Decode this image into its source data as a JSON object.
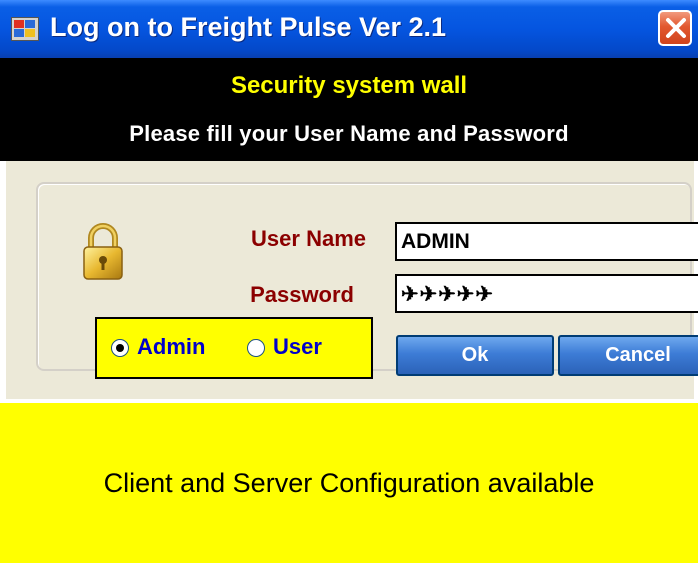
{
  "window": {
    "title": "Log on to Freight Pulse Ver 2.1",
    "app_icon": "app-window-icon",
    "close_icon": "close-icon"
  },
  "header": {
    "title": "Security system wall",
    "subtitle": "Please fill your User Name and Password"
  },
  "form": {
    "lock_icon": "padlock-icon",
    "username_label": "User Name",
    "username_value": "ADMIN",
    "password_label": "Password",
    "password_value": "✈✈✈✈✈",
    "role_options": [
      {
        "label": "Admin",
        "selected": true
      },
      {
        "label": "User",
        "selected": false
      }
    ],
    "ok_label": "Ok",
    "cancel_label": "Cancel"
  },
  "footer": {
    "text": "Client and Server Configuration available"
  },
  "colors": {
    "header_bg": "#000000",
    "header_title": "#ffff00",
    "label_color": "#8b0000",
    "radio_label": "#0000cc",
    "footer_bg": "#ffff00"
  }
}
